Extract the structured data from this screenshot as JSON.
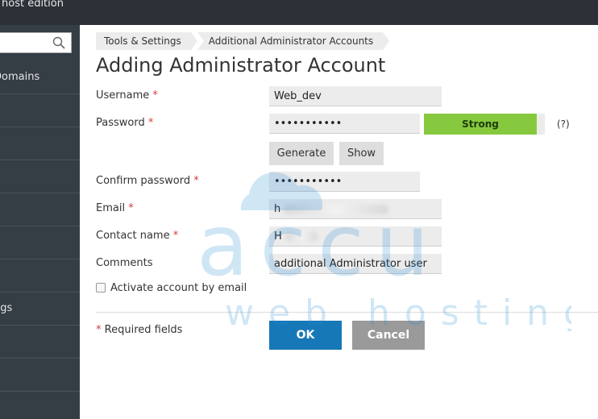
{
  "topbar": {
    "title": "host edition"
  },
  "sidebar": {
    "items": [
      {
        "label": "Domains"
      },
      {
        "label": ""
      },
      {
        "label": ""
      },
      {
        "label": ""
      },
      {
        "label": ""
      },
      {
        "label": ""
      },
      {
        "label": ""
      },
      {
        "label": "ngs"
      },
      {
        "label": ""
      },
      {
        "label": ""
      }
    ]
  },
  "breadcrumb": [
    "Tools & Settings",
    "Additional Administrator Accounts"
  ],
  "page_title": "Adding Administrator Account",
  "form": {
    "username_label": "Username",
    "username_value": "Web_dev",
    "password_label": "Password",
    "password_value": "•••••••••••",
    "password_strength": "Strong",
    "help_text": "(?)",
    "generate_label": "Generate",
    "show_label": "Show",
    "confirm_label": "Confirm password",
    "confirm_value": "•••••••••••",
    "email_label": "Email",
    "email_value": "h",
    "contact_label": "Contact name",
    "contact_value": "H",
    "comments_label": "Comments",
    "comments_value": "additional Administrator user",
    "activate_label": "Activate account by email",
    "required_star": "*",
    "required_note": "Required fields",
    "ok_label": "OK",
    "cancel_label": "Cancel"
  },
  "watermark": {
    "line1": "accu",
    "line2": "web hosting"
  },
  "colors": {
    "ok": "#1778b7",
    "strength": "#86c93e",
    "required": "#d43a3a"
  }
}
